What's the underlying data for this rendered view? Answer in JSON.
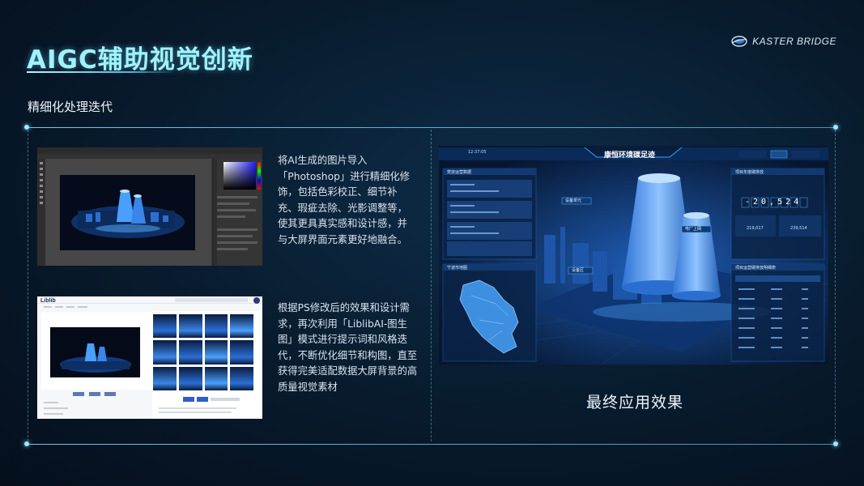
{
  "header": {
    "title": "AIGC辅助视觉创新",
    "brand": "KASTER BRIDGE",
    "subtitle": "精细化处理迭代"
  },
  "steps": [
    {
      "lines": [
        "将AI生成的图片导入",
        "「Photoshop」进行精细化修",
        "饰，包括色彩校正、细节补",
        "充、瑕疵去除、光影调整等，",
        "使其更具真实感和设计感，并",
        "与大屏界面元素更好地融合。"
      ]
    },
    {
      "lines": [
        "根据PS修改后的效果和设计需",
        "求，再次利用「LiblibAI-图生",
        "图」模式进行提示词和风格迭",
        "代，不断优化细节和构图，直至",
        "获得完美适配数据大屏背景的高",
        "质量视觉素材"
      ]
    }
  ],
  "liblib": {
    "logo": "Liblib"
  },
  "dashboard": {
    "title": "康恒环境碳足迹",
    "time": "12:37:05",
    "left_panel_title": "焚烧运营数据",
    "map_title": "宁波市地图",
    "right_panel_title": "项目年度碳排放",
    "counter": "-20,524",
    "metric_a": "219,017",
    "metric_b": "239,514",
    "table_title": "项目运营碳排放明细表",
    "tags": [
      "设备单元",
      "电厂上网",
      "设备区"
    ]
  },
  "final_label": "最终应用效果",
  "colors": {
    "accent": "#9ff3ff",
    "line": "#78dcff",
    "ps_bg": "#3c3c3c",
    "dash_bg": "#071a33"
  }
}
